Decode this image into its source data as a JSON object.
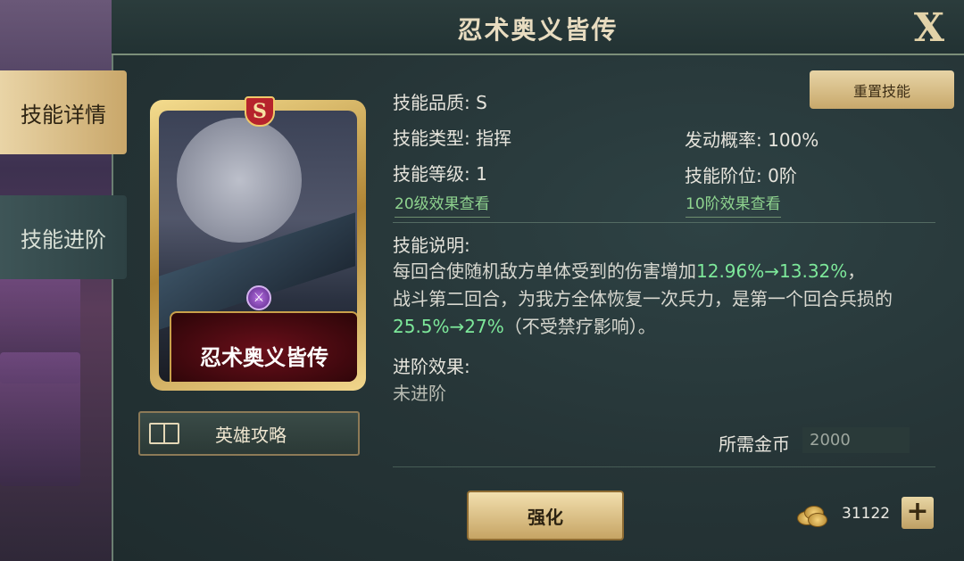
{
  "header": {
    "title": "忍术奥义皆传",
    "close_label": "X"
  },
  "tabs": [
    {
      "label": "技能详情",
      "active": true
    },
    {
      "label": "技能进阶",
      "active": false
    }
  ],
  "card": {
    "name": "忍术奥义皆传",
    "grade_badge": "S"
  },
  "guide_button": {
    "label": "英雄攻略"
  },
  "reset_button": {
    "label": "重置技能"
  },
  "skill": {
    "quality": "技能品质: S",
    "type": "技能类型: 指挥",
    "chance": "发动概率: 100%",
    "level": "技能等级: 1",
    "tier": "技能阶位: 0阶",
    "level_link": "20级效果查看",
    "tier_link": "10阶效果查看",
    "desc_title": "技能说明:",
    "desc_parts": [
      "每回合使随机敌方单体受到的伤害增加",
      "12.96%→13.32%",
      "，",
      "战斗第二回合，为我方全体恢复一次兵力，是第一个回合兵损的",
      "25.5%→27%",
      "（不受禁疗影响）。"
    ],
    "advance_title": "进阶效果:",
    "advance_value": "未进阶"
  },
  "cost": {
    "label": "所需金币",
    "value": "2000"
  },
  "enhance_button": {
    "label": "强化"
  },
  "gold": {
    "amount": "31122",
    "add_label": "+"
  },
  "colors": {
    "highlight": "#7de89a",
    "link": "#8fd48f",
    "gold": "#c9a76a"
  }
}
